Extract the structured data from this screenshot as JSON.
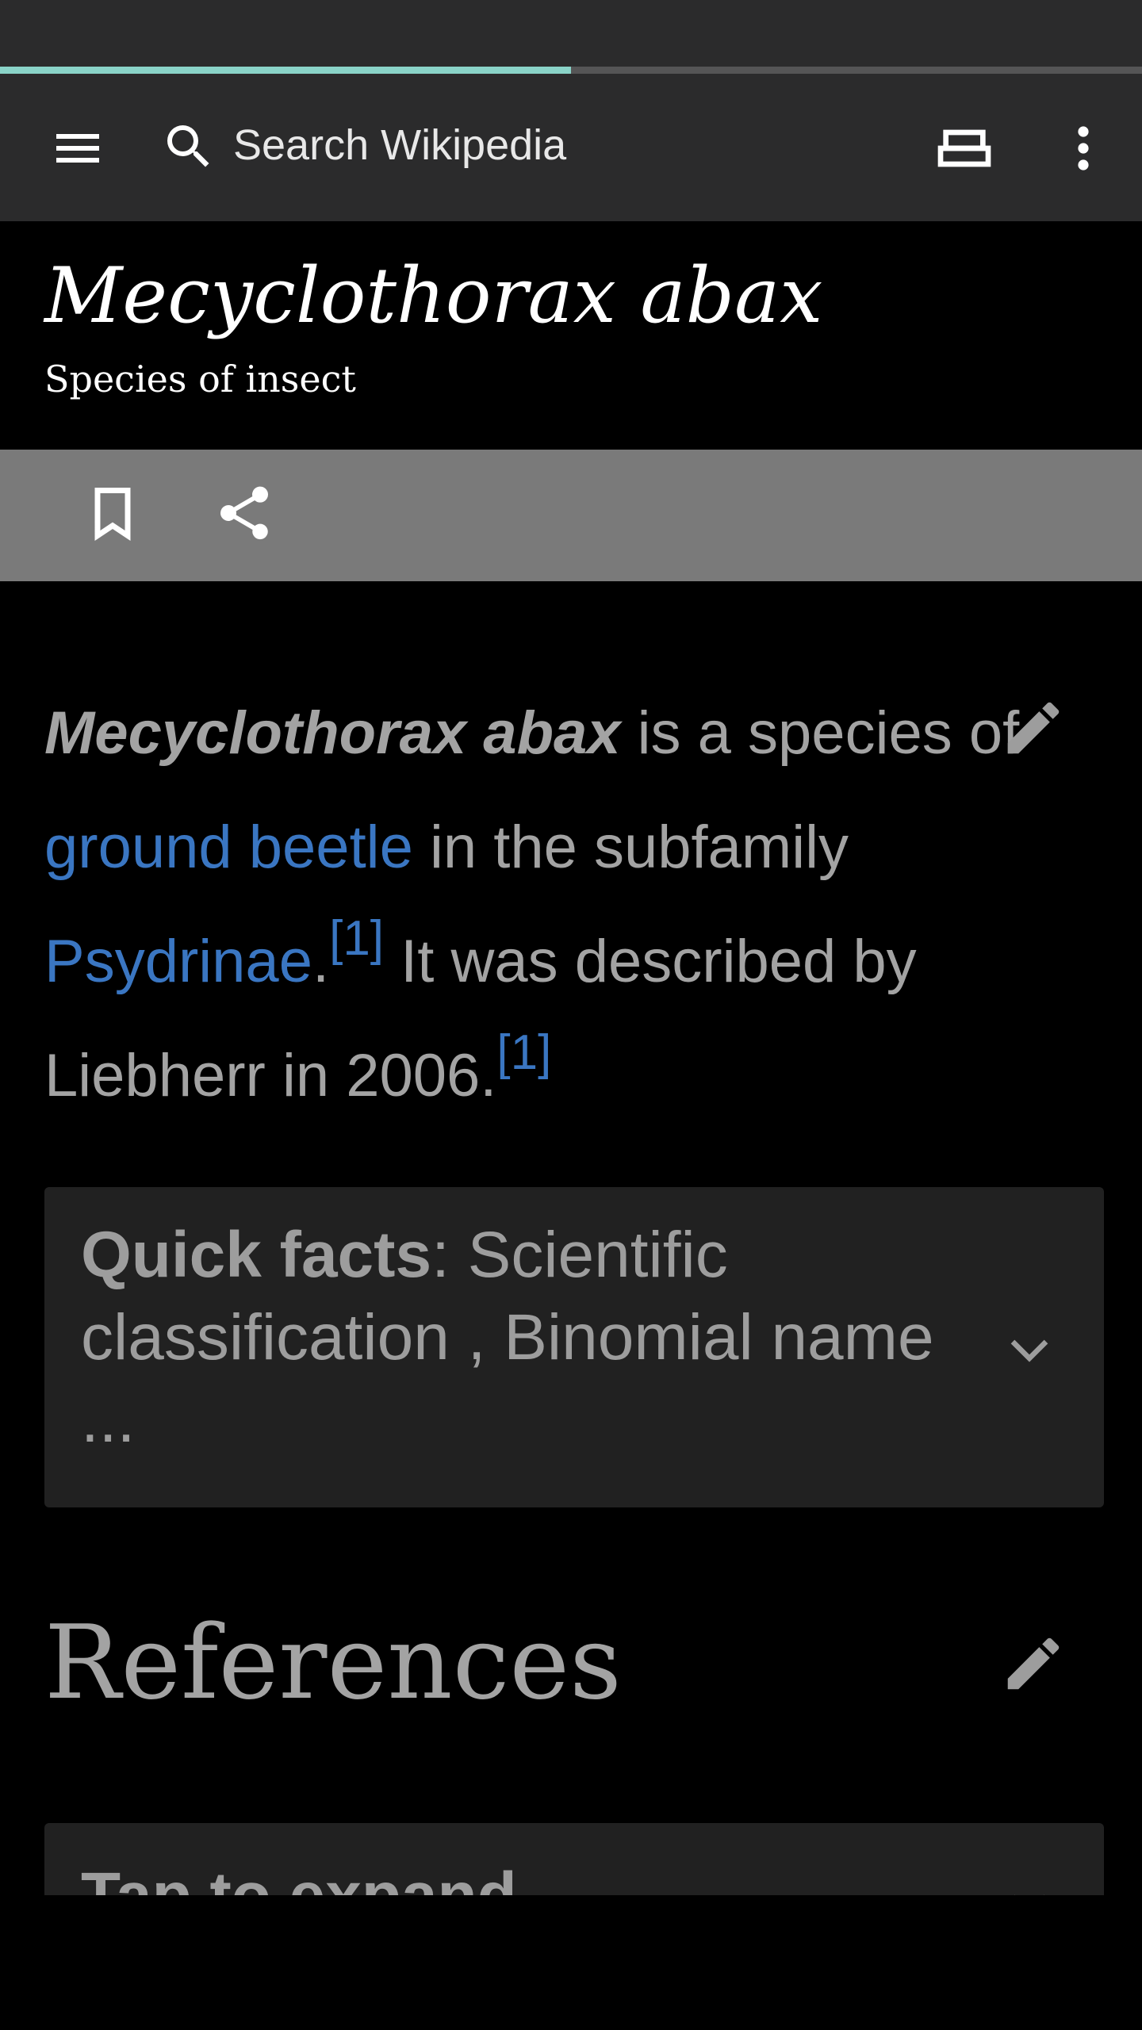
{
  "page_load_progress": 0.5,
  "toolbar": {
    "search_placeholder": "Search Wikipedia",
    "icons": [
      "menu-icon",
      "search-icon",
      "tabs-icon",
      "more-vertical-icon"
    ]
  },
  "article": {
    "title": "Mecyclothorax abax",
    "subtitle": "Species of insect",
    "intro": {
      "subject": "Mecyclothorax abax",
      "text1": " is a species of ",
      "link1": "ground beetle",
      "text2": " in the subfamily ",
      "link2": "Psydrinae",
      "text3": ".",
      "ref1": "[1]",
      "text4": " It was described by Liebherr in 2006.",
      "ref2": "[1]"
    }
  },
  "actions": {
    "icons": [
      "bookmark-icon",
      "share-icon"
    ]
  },
  "quick_facts": {
    "label": "Quick facts",
    "text": ": Scientific classification , Binomial name ..."
  },
  "references": {
    "heading": "References",
    "collapsed_label": "Tap to expand"
  },
  "colors": {
    "toolbar_bg": "#2b2b2c",
    "progress_fill": "#8ad3c8",
    "action_bar_bg": "#7a7a7a",
    "link": "#3a76c2",
    "body_text": "#a3a3a3"
  }
}
